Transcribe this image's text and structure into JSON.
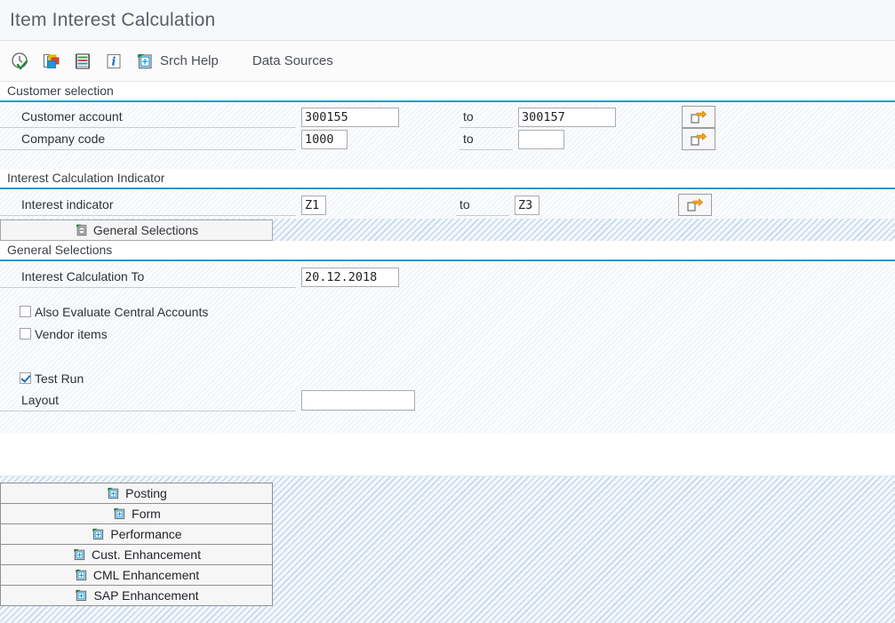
{
  "window": {
    "title": "Item Interest Calculation"
  },
  "toolbar": {
    "items": [
      {
        "id": "execute",
        "icon": "clock-check-icon",
        "label": ""
      },
      {
        "id": "get-variant",
        "icon": "variant-icon",
        "label": ""
      },
      {
        "id": "list-display",
        "icon": "list-stripes-icon",
        "label": ""
      },
      {
        "id": "information",
        "icon": "info-icon",
        "label": ""
      },
      {
        "id": "search-help",
        "icon": "search-help-icon",
        "label": "Srch Help"
      },
      {
        "id": "data-sources",
        "icon": "",
        "label": "Data Sources"
      }
    ]
  },
  "customer_selection": {
    "header": "Customer selection",
    "rows": [
      {
        "label": "Customer account",
        "from_value": "300155",
        "to_label": "to",
        "to_value": "300157",
        "multi_button": "multiple-selection-icon"
      },
      {
        "label": "Company code",
        "from_value": "1000",
        "to_label": "to",
        "to_value": "",
        "multi_button": "multiple-selection-icon"
      }
    ]
  },
  "interest_indicator_section": {
    "header": "Interest Calculation Indicator",
    "rows": [
      {
        "label": "Interest indicator",
        "from_value": "Z1",
        "to_label": "to",
        "to_value": "Z3",
        "multi_button": "multiple-selection-icon"
      }
    ]
  },
  "tabstrip": {
    "tabs": [
      {
        "id": "general-selections",
        "label": "General Selections",
        "icon": "expand-node-icon",
        "active": true
      }
    ]
  },
  "general_selections": {
    "header": "General Selections",
    "date_row": {
      "label": "Interest Calculation To",
      "value": "20.12.2018"
    },
    "checkboxes": [
      {
        "id": "also-evaluate-central-accounts",
        "label": "Also Evaluate Central Accounts",
        "checked": false
      },
      {
        "id": "vendor-items",
        "label": "Vendor items",
        "checked": false
      },
      {
        "id": "test-run",
        "label": "Test Run",
        "checked": true
      }
    ],
    "layout_row": {
      "label": "Layout",
      "value": "",
      "placeholder": ""
    }
  },
  "bottom_buttons": [
    {
      "id": "posting",
      "label": "Posting",
      "icon": "flag-expand-icon"
    },
    {
      "id": "form",
      "label": "Form",
      "icon": "flag-expand-icon"
    },
    {
      "id": "performance",
      "label": "Performance",
      "icon": "flag-expand-icon"
    },
    {
      "id": "cust-enhancement",
      "label": "Cust. Enhancement",
      "icon": "flag-expand-icon"
    },
    {
      "id": "cml-enhancement",
      "label": "CML Enhancement",
      "icon": "flag-expand-icon"
    },
    {
      "id": "sap-enhancement",
      "label": "SAP Enhancement",
      "icon": "flag-expand-icon"
    }
  ],
  "colors": {
    "accent_blue": "#1c9ad6",
    "title_text": "#5a6068",
    "icon_orange": "#f5a623",
    "icon_green": "#1f7a33",
    "icon_blue": "#2196d4",
    "check_blue": "#1573c4"
  }
}
